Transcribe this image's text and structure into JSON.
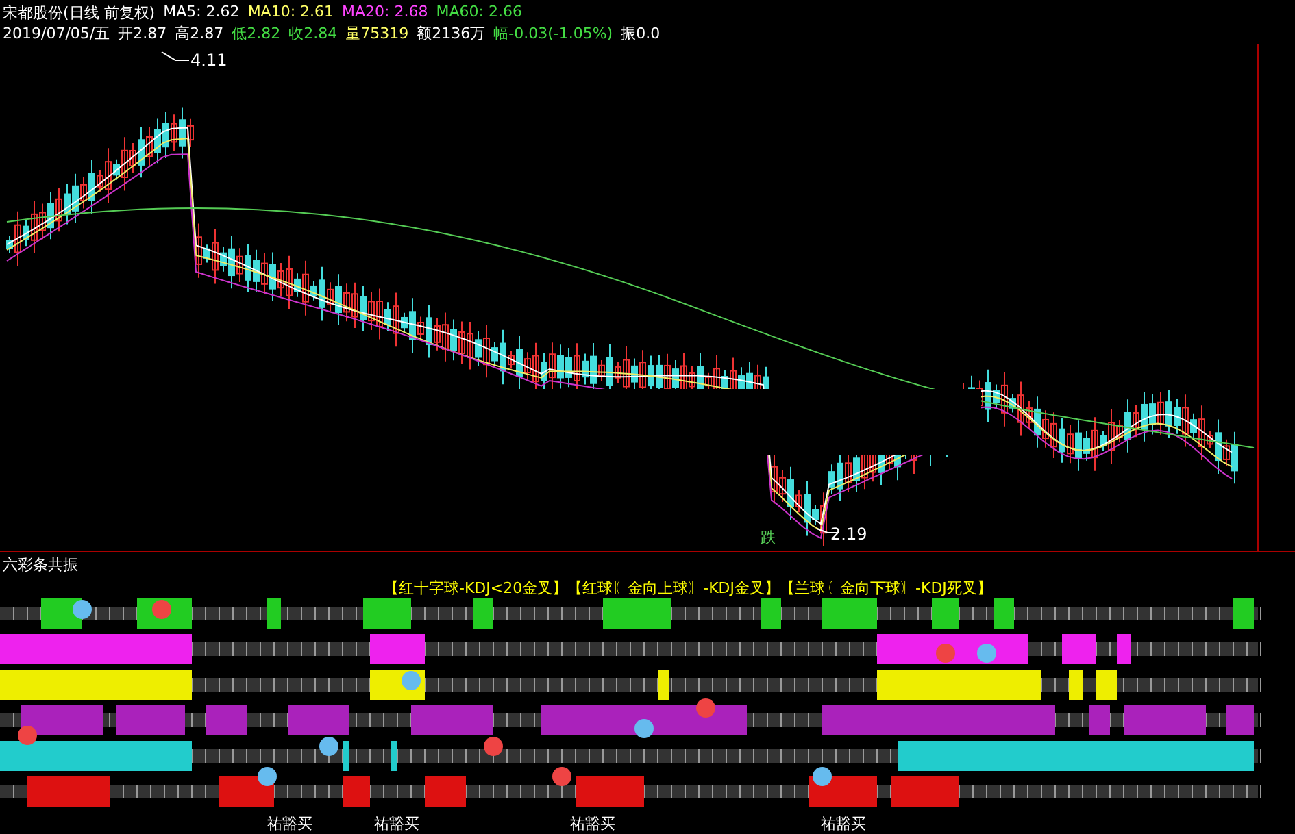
{
  "header": {
    "stock": "宋都股份(日线 前复权)",
    "ma": [
      {
        "label": "MA5: 2.62",
        "color": "#ffffff"
      },
      {
        "label": "MA10: 2.61",
        "color": "#ffff66"
      },
      {
        "label": "MA20: 2.68",
        "color": "#ff44ff"
      },
      {
        "label": "MA60: 2.66",
        "color": "#44dd44"
      }
    ],
    "quote": [
      {
        "label": "2019/07/05/五",
        "color": "#ffffff"
      },
      {
        "label": "开2.87",
        "color": "#ffffff"
      },
      {
        "label": "高2.87",
        "color": "#ffffff"
      },
      {
        "label": "低2.82",
        "color": "#44dd44"
      },
      {
        "label": "收2.84",
        "color": "#44dd44"
      },
      {
        "label": "量75319",
        "color": "#ffff66"
      },
      {
        "label": "额2136万",
        "color": "#ffffff"
      },
      {
        "label": "幅-0.03(-1.05%)",
        "color": "#44dd44"
      },
      {
        "label": "振0.0",
        "color": "#ffffff"
      }
    ]
  },
  "chart": {
    "high_label": "4.11",
    "low_label": "2.19",
    "signal": "跌"
  },
  "indicator": {
    "title": "六彩条共振",
    "legend": "【红十字球-KDJ<20金叉】【红球〖金向上球〗-KDJ金叉】【兰球〖金向下球〗-KDJ死叉】",
    "buy_labels": [
      "祐豁买",
      "祐豁买",
      "祐豁买",
      "祐豁买"
    ]
  }
}
